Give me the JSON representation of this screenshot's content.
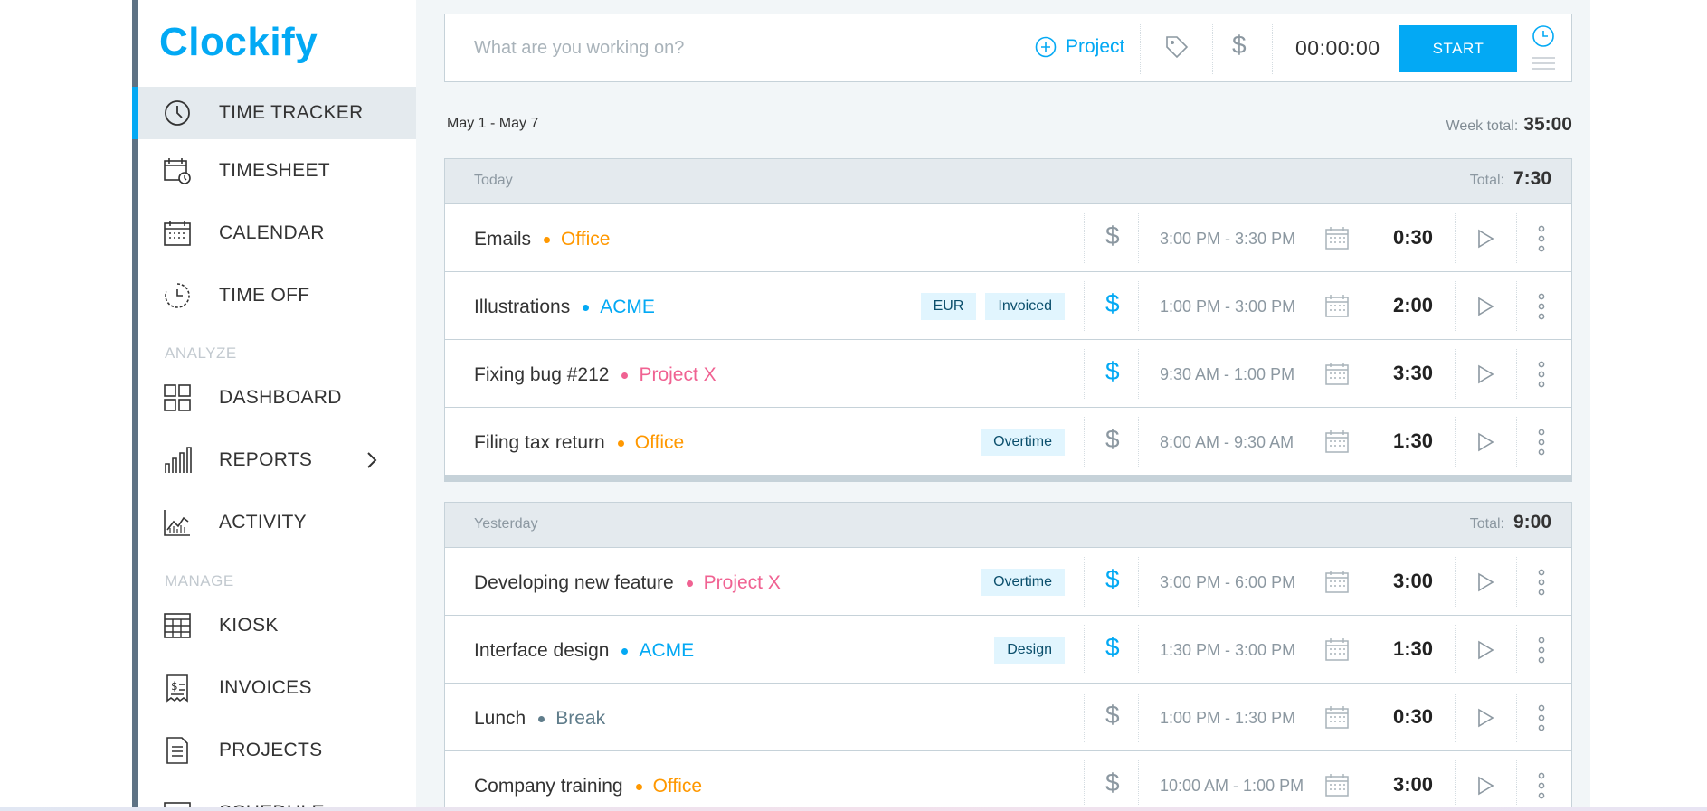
{
  "app": {
    "logo_text": "Clockify",
    "accent": "#03a9f4"
  },
  "sidebar": {
    "items": [
      {
        "label": "TIME TRACKER",
        "icon": "clock-icon",
        "active": true
      },
      {
        "label": "TIMESHEET",
        "icon": "timesheet-icon"
      },
      {
        "label": "CALENDAR",
        "icon": "calendar-icon"
      },
      {
        "label": "TIME OFF",
        "icon": "time-off-icon"
      },
      {
        "label": "DASHBOARD",
        "icon": "dashboard-icon"
      },
      {
        "label": "REPORTS",
        "icon": "reports-icon"
      },
      {
        "label": "ACTIVITY",
        "icon": "activity-icon"
      },
      {
        "label": "KIOSK",
        "icon": "kiosk-icon"
      },
      {
        "label": "INVOICES",
        "icon": "invoices-icon"
      },
      {
        "label": "PROJECTS",
        "icon": "projects-icon"
      },
      {
        "label": "SCHEDULE",
        "icon": "schedule-icon"
      }
    ],
    "sections": {
      "analyze": "ANALYZE",
      "manage": "MANAGE"
    }
  },
  "timer": {
    "placeholder": "What are you working on?",
    "project_label": "Project",
    "dollar": "$",
    "time": "00:00:00",
    "start_label": "START"
  },
  "week": {
    "range": "May 1 - May 7",
    "total_label": "Week total:",
    "total": "35:00"
  },
  "groups": [
    {
      "title": "Today",
      "total_label": "Total:",
      "total": "7:30",
      "entries": [
        {
          "desc": "Emails",
          "project": "Office",
          "color": "#ff9800",
          "tags": [],
          "billable": false,
          "range": "3:00 PM - 3:30 PM",
          "duration": "0:30"
        },
        {
          "desc": "Illustrations",
          "project": "ACME",
          "color": "#03a9f4",
          "tags": [
            "EUR",
            "Invoiced"
          ],
          "billable": true,
          "range": "1:00 PM - 3:00 PM",
          "duration": "2:00"
        },
        {
          "desc": "Fixing bug #212",
          "project": "Project X",
          "color": "#f06292",
          "tags": [],
          "billable": true,
          "range": "9:30 AM - 1:00 PM",
          "duration": "3:30"
        },
        {
          "desc": "Filing tax return",
          "project": "Office",
          "color": "#ff9800",
          "tags": [
            "Overtime"
          ],
          "billable": false,
          "range": "8:00 AM - 9:30 AM",
          "duration": "1:30"
        }
      ]
    },
    {
      "title": "Yesterday",
      "total_label": "Total:",
      "total": "9:00",
      "entries": [
        {
          "desc": "Developing new feature",
          "project": "Project X",
          "color": "#f06292",
          "tags": [
            "Overtime"
          ],
          "billable": true,
          "range": "3:00 PM - 6:00 PM",
          "duration": "3:00"
        },
        {
          "desc": "Interface design",
          "project": "ACME",
          "color": "#03a9f4",
          "tags": [
            "Design"
          ],
          "billable": true,
          "range": "1:30 PM - 3:00 PM",
          "duration": "1:30"
        },
        {
          "desc": "Lunch",
          "project": "Break",
          "color": "#607d8b",
          "tags": [],
          "billable": false,
          "range": "1:00 PM - 1:30 PM",
          "duration": "0:30"
        },
        {
          "desc": "Company training",
          "project": "Office",
          "color": "#ff9800",
          "tags": [],
          "billable": false,
          "range": "10:00 AM - 1:00 PM",
          "duration": "3:00"
        }
      ]
    }
  ]
}
